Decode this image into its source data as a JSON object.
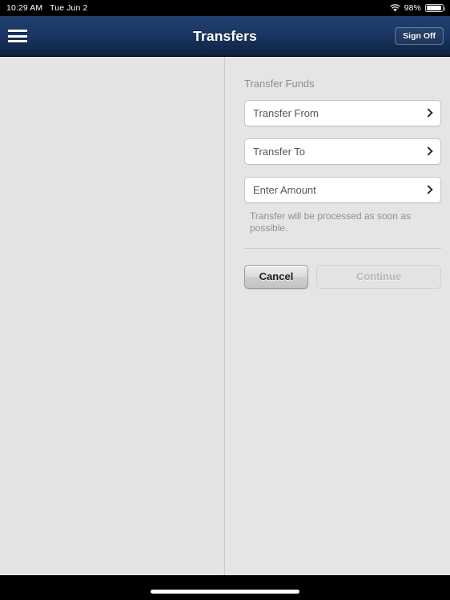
{
  "status_bar": {
    "time": "10:29 AM",
    "date": "Tue Jun 2",
    "wifi_icon": "wifi-icon",
    "battery_percent": "98%",
    "battery_icon": "battery-icon"
  },
  "nav_bar": {
    "menu_icon": "hamburger-menu-icon",
    "title": "Transfers",
    "sign_off_label": "Sign Off",
    "background_color": "#1b3763"
  },
  "left_pane": {
    "content": ""
  },
  "form": {
    "section_title": "Transfer Funds",
    "rows": [
      {
        "label": "Transfer From",
        "value": "",
        "chevron": "chevron-right-icon"
      },
      {
        "label": "Transfer To",
        "value": "",
        "chevron": "chevron-right-icon"
      },
      {
        "label": "Enter Amount",
        "value": "",
        "chevron": "chevron-right-icon"
      }
    ],
    "note": "Transfer will be processed as soon as possible."
  },
  "actions": {
    "cancel_label": "Cancel",
    "continue_label": "Continue",
    "continue_enabled": false
  },
  "colors": {
    "nav_top": "#20406e",
    "nav_bottom": "#0d2040",
    "page_background": "#e4e4e4",
    "field_background": "#ffffff",
    "muted_text": "#8c8c8c",
    "field_text": "#565656"
  }
}
